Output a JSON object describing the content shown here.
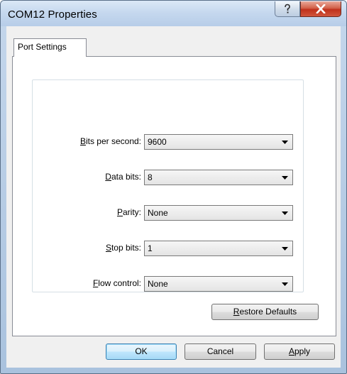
{
  "window": {
    "title": "COM12 Properties",
    "help_glyph": "?",
    "close_glyph": "X"
  },
  "tabs": [
    {
      "label": "Port Settings",
      "active": true
    }
  ],
  "port_settings": {
    "bits_per_second": {
      "label_accel": "B",
      "label_rest": "its per second:",
      "value": "9600"
    },
    "data_bits": {
      "label_accel": "D",
      "label_rest": "ata bits:",
      "value": "8"
    },
    "parity": {
      "label_pre": "",
      "label_accel": "P",
      "label_rest": "arity:",
      "value": "None"
    },
    "stop_bits": {
      "label_accel": "S",
      "label_rest": "top bits:",
      "value": "1"
    },
    "flow_control": {
      "label_accel": "F",
      "label_rest": "low control:",
      "value": "None"
    }
  },
  "buttons": {
    "restore_defaults": {
      "accel": "R",
      "rest": "estore Defaults"
    },
    "ok": "OK",
    "cancel": "Cancel",
    "apply": {
      "accel": "A",
      "rest": "pply"
    }
  },
  "colors": {
    "frame": "#b7cde8",
    "close_button": "#c0301b",
    "default_button_border": "#3c7fb1",
    "dialog_bg": "#f0f0f0"
  }
}
